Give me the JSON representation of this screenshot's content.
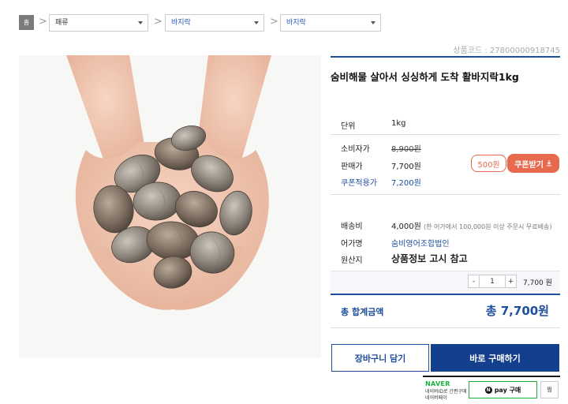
{
  "breadcrumb": {
    "home_label": "홈",
    "separator": ">",
    "categories": [
      {
        "label": "패류"
      },
      {
        "label": "바지락"
      },
      {
        "label": "바지락"
      }
    ]
  },
  "product": {
    "code": "상품코드 : 27800000918745",
    "title": "숨비해물 살아서 싱싱하게 도착 활바지락1kg",
    "unit_label": "단위",
    "unit_value": "1kg",
    "consumer_price_label": "소비자가",
    "consumer_price": "8,900원",
    "sale_price_label": "판매가",
    "sale_price": "7,700원",
    "coupon_price_label": "쿠폰적용가",
    "coupon_price": "7,200원",
    "coupon_amount": "500원",
    "coupon_button": "쿠폰받기",
    "shipping_label": "배송비",
    "shipping_value": "4,000원",
    "shipping_note": "(한 어가에서 100,000원 이상 주문시 무료배송)",
    "fisher_label": "어가명",
    "fisher_value": "숨비영어조합법인",
    "origin_label": "원산지",
    "origin_value": "상품정보 고시 참고"
  },
  "quantity": {
    "minus": "-",
    "value": "1",
    "plus": "+",
    "line_price": "7,700 원"
  },
  "total": {
    "label": "총 합계금액",
    "value": "총 7,700원"
  },
  "actions": {
    "cart": "장바구니 담기",
    "buy": "바로 구매하기"
  },
  "npay": {
    "brand": "NAVER",
    "desc1": "네이버ID로 간편구매",
    "desc2": "네이버페이",
    "pay_icon": "N",
    "pay_label": "pay 구매",
    "wish_label": "찜"
  },
  "colors": {
    "accent": "#1d4f9c",
    "coupon": "#e86a4e",
    "naver": "#19b33c"
  }
}
